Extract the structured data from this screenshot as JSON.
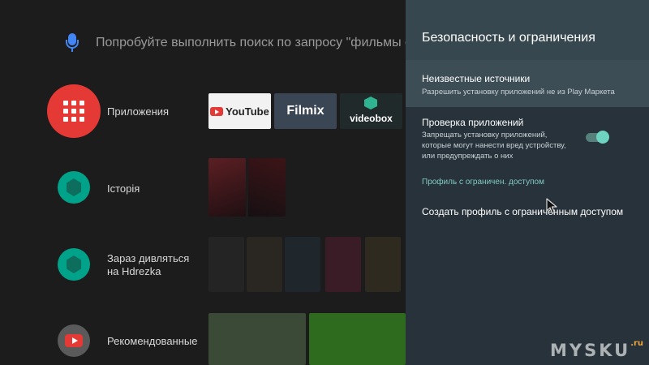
{
  "search": {
    "hint": "Попробуйте выполнить поиск по запросу \"фильмы о футбол"
  },
  "launcher": {
    "rows": [
      {
        "label": "Приложения"
      },
      {
        "label": "Історія"
      },
      {
        "label": "Зараз дивляться на Hdrezka"
      },
      {
        "label": "Рекомендованные"
      }
    ],
    "apps": [
      {
        "name": "YouTube"
      },
      {
        "name": "Filmix"
      },
      {
        "name": "videobox"
      }
    ]
  },
  "panel": {
    "title": "Безопасность и ограничения",
    "unknown_sources": {
      "title": "Неизвестные источники",
      "subtitle": "Разрешить установку приложений не из Play Маркета"
    },
    "verify_apps": {
      "title": "Проверка приложений",
      "subtitle": "Запрещать установку приложений, которые могут нанести вред устройству, или предупреждать о них",
      "enabled": true
    },
    "restricted_section": "Профиль с ограничен. доступом",
    "create_restricted": "Создать профиль с ограниченным доступом"
  },
  "watermark": {
    "text": "MYSKU",
    "suffix": ".ru"
  },
  "colors": {
    "apps_red": "#e53935",
    "accent_teal": "#80cbc4",
    "panel_bg": "#27323a",
    "panel_header": "#37474f",
    "selected_item": "#3d4d55"
  }
}
